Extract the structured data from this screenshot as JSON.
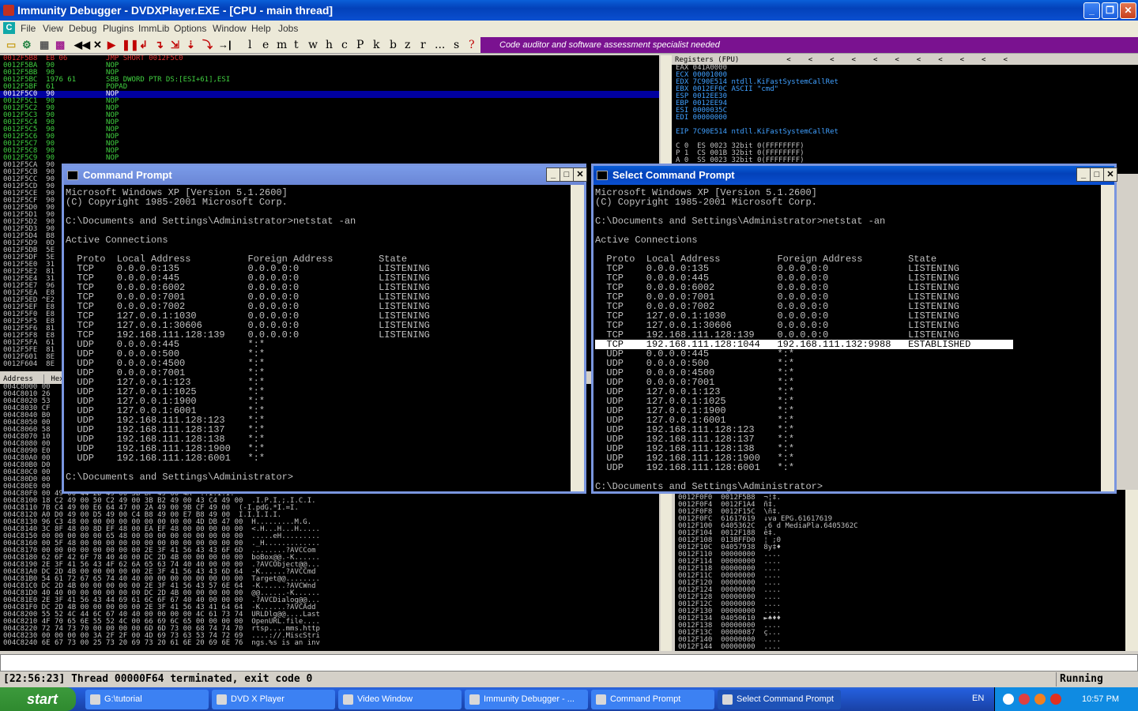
{
  "window": {
    "title": "Immunity Debugger - DVDXPlayer.EXE - [CPU - main thread]"
  },
  "menu": [
    "File",
    "View",
    "Debug",
    "Plugins",
    "ImmLib",
    "Options",
    "Window",
    "Help",
    "Jobs"
  ],
  "toolbar_letters": [
    "l",
    "e",
    "m",
    "t",
    "w",
    "h",
    "c",
    "P",
    "k",
    "b",
    "z",
    "r",
    "...",
    "s",
    "?"
  ],
  "banner": "Code auditor and software assessment specialist needed",
  "disasm": [
    "0012F5B8  EB 06         JMP SHORT 0012F5C0",
    "0012F5BA  90            NOP",
    "0012F5BB  90            NOP",
    "0012F5BC  1976 61       SBB DWORD PTR DS:[ESI+61],ESI",
    "0012F5BF  61            POPAD",
    "0012F5C0  90            NOP",
    "0012F5C1  90            NOP",
    "0012F5C2  90            NOP",
    "0012F5C3  90            NOP",
    "0012F5C4  90            NOP",
    "0012F5C5  90            NOP",
    "0012F5C6  90            NOP",
    "0012F5C7  90            NOP",
    "0012F5C8  90            NOP",
    "0012F5C9  90            NOP",
    "0012F5CA  90",
    "0012F5CB  90",
    "0012F5CC  90",
    "0012F5CD  90",
    "0012F5CE  90",
    "0012F5CF  90",
    "0012F5D0  90",
    "0012F5D1  90",
    "0012F5D2  90",
    "0012F5D3  90",
    "0012F5D4  B8",
    "0012F5D9  0D",
    "0012F5DB  5E",
    "0012F5DF  5E",
    "0012F5E0  31",
    "0012F5E2  81",
    "0012F5E4  31",
    "0012F5E7  96",
    "0012F5EA  E8",
    "0012F5ED ^E2",
    "0012F5EF  E8",
    "0012F5F0  E8",
    "0012F5F5  E8",
    "0012F5F6  81",
    "0012F5F8  E8",
    "0012F5FA  61",
    "0012F5FE  81",
    "0012F601  8E",
    "0012F604  8E"
  ],
  "registers": {
    "header": "Registers (FPU)",
    "rows": [
      "EAX 041A0000",
      "ECX 00001000",
      "EDX 7C90E514 ntdll.KiFastSystemCallRet",
      "EBX 0012EF0C ASCII \"cmd\"",
      "ESP 0012EE30",
      "EBP 0012EE94",
      "ESI 0000035C",
      "EDI 00000000",
      "",
      "EIP 7C90E514 ntdll.KiFastSystemCallRet",
      "",
      "C 0  ES 0023 32bit 0(FFFFFFFF)",
      "P 1  CS 001B 32bit 0(FFFFFFFF)",
      "A 0  SS 0023 32bit 0(FFFFFFFF)"
    ]
  },
  "dump": {
    "col_address": "Address",
    "col_hex": "Hex",
    "rows": [
      "004C8000 00",
      "004C8010 26",
      "004C8020 53",
      "004C8030 CF",
      "004C8040 B0",
      "004C8050 00",
      "004C8060 58",
      "004C8070 10",
      "004C8080 00",
      "004C8090 E0",
      "004C80A0 00",
      "004C80B0 D0",
      "004C80C0 00",
      "004C80D0 00",
      "004C80E0 00",
      "004C80F0 00 49 00 44 2D 49 00 3B BF 49 00 4A  ..I.I.I.",
      "004C8100 18 C2 49 00 50 C2 49 00 3B B2 49 00 43 C4 49 00  .I.P.I.;.I.C.I.",
      "004C8110 7B C4 49 00 E6 64 47 00 2A 49 00 9B CF 49 00  (-I.pdG.*I.=I.",
      "004C8120 A0 D0 49 00 D5 49 00 C4 B8 49 00 E7 B8 49 00  I.I.I.I.I.",
      "004C8130 96 C3 48 00 00 00 00 00 00 00 00 00 4D DB 47 00  H.........M.G.",
      "004C8140 3C 8F 48 00 8D EF 48 00 EA EF 48 00 00 00 00 00  <.H...H...H.....",
      "004C8150 00 00 00 00 00 65 48 00 00 00 00 00 00 00 00 00  .....eH.........",
      "004C8160 00 5F 48 00 00 00 00 00 00 00 00 00 00 00 00 00  ._H.............",
      "004C8170 00 00 00 00 00 00 00 00 2E 3F 41 56 43 43 6F 6D  ........?AVCCom",
      "004C8180 62 6F 42 6F 78 40 40 00 DC 2D 4B 00 00 00 00 00  boBox@@.-K......",
      "004C8190 2E 3F 41 56 43 4F 62 6A 65 63 74 40 40 00 00 00  .?AVCObject@@...",
      "004C81A0 DC 2D 4B 00 00 00 00 00 2E 3F 41 56 43 43 6D 64  -K......?AVCCmd",
      "004C81B0 54 61 72 67 65 74 40 40 00 00 00 00 00 00 00 00  Target@@........",
      "004C81C0 DC 2D 4B 00 00 00 00 00 2E 3F 41 56 43 57 6E 64  -K......?AVCWnd",
      "004C81D0 40 40 00 00 00 00 00 00 DC 2D 4B 00 00 00 00 00  @@......-K......",
      "004C81E0 2E 3F 41 56 43 44 69 61 6C 6F 67 40 40 00 00 00  .?AVCDialog@@...",
      "004C81F0 DC 2D 4B 00 00 00 00 00 2E 3F 41 56 43 41 64 64  -K......?AVCAdd",
      "004C8200 55 52 4C 44 6C 67 40 40 00 00 00 00 4C 61 73 74  URLDlg@@....Last",
      "004C8210 4F 70 65 6E 55 52 4C 00 66 69 6C 65 00 00 00 00  OpenURL.file....",
      "004C8220 72 74 73 70 00 00 00 00 6D 6D 73 00 68 74 74 70  rtsp....mms.http",
      "004C8230 00 00 00 00 3A 2F 2F 00 4D 69 73 63 53 74 72 69  ....://.MiscStri",
      "004C8240 6E 67 73 00 25 73 20 69 73 20 61 6E 20 69 6E 76  ngs.%s is an inv"
    ]
  },
  "stack": {
    "rows": [
      "0012F0F0  0012F5B8  ¬¦‡.",
      "0012F0F4  0012F1A4  ñ‡.",
      "0012F0F8  0012F15C  \\ñ‡.",
      "0012F0FC  61617619  ↓va EPG.61617619",
      "0012F100  6405362C  ,6 d MediaPla.6405362C",
      "0012F104  0012F188  ê‡.",
      "0012F108  013BFFD0  ¦ ;0",
      "0012F10C  04057938  8y‡♦",
      "0012F110  00000000  ....",
      "0012F114  00000000  ....",
      "0012F118  00000000  ....",
      "0012F11C  00000000  ....",
      "0012F120  00000000  ....",
      "0012F124  00000000  ....",
      "0012F128  00000000  ....",
      "0012F12C  00000000  ....",
      "0012F130  00000000  ....",
      "0012F134  04050610  ►♠♦♦",
      "0012F138  00000000  ....",
      "0012F13C  00000087  ç...",
      "0012F140  00000000  ....",
      "0012F144  00000000  ...."
    ]
  },
  "status": {
    "message": "[22:56:23] Thread 00000F64 terminated, exit code 0",
    "state": "Running"
  },
  "cmd1": {
    "title": "Command Prompt",
    "lines": [
      "Microsoft Windows XP [Version 5.1.2600]",
      "(C) Copyright 1985-2001 Microsoft Corp.",
      "",
      "C:\\Documents and Settings\\Administrator>netstat -an",
      "",
      "Active Connections",
      "",
      "  Proto  Local Address          Foreign Address        State",
      "  TCP    0.0.0.0:135            0.0.0.0:0              LISTENING",
      "  TCP    0.0.0.0:445            0.0.0.0:0              LISTENING",
      "  TCP    0.0.0.0:6002           0.0.0.0:0              LISTENING",
      "  TCP    0.0.0.0:7001           0.0.0.0:0              LISTENING",
      "  TCP    0.0.0.0:7002           0.0.0.0:0              LISTENING",
      "  TCP    127.0.0.1:1030         0.0.0.0:0              LISTENING",
      "  TCP    127.0.0.1:30606        0.0.0.0:0              LISTENING",
      "  TCP    192.168.111.128:139    0.0.0.0:0              LISTENING",
      "  UDP    0.0.0.0:445            *:*",
      "  UDP    0.0.0.0:500            *:*",
      "  UDP    0.0.0.0:4500           *:*",
      "  UDP    0.0.0.0:7001           *:*",
      "  UDP    127.0.0.1:123          *:*",
      "  UDP    127.0.0.1:1025         *:*",
      "  UDP    127.0.0.1:1900         *:*",
      "  UDP    127.0.0.1:6001         *:*",
      "  UDP    192.168.111.128:123    *:*",
      "  UDP    192.168.111.128:137    *:*",
      "  UDP    192.168.111.128:138    *:*",
      "  UDP    192.168.111.128:1900   *:*",
      "  UDP    192.168.111.128:6001   *:*",
      "",
      "C:\\Documents and Settings\\Administrator>"
    ]
  },
  "cmd2": {
    "title": "Select Command Prompt",
    "highlight_index": 16,
    "lines": [
      "Microsoft Windows XP [Version 5.1.2600]",
      "(C) Copyright 1985-2001 Microsoft Corp.",
      "",
      "C:\\Documents and Settings\\Administrator>netstat -an",
      "",
      "Active Connections",
      "",
      "  Proto  Local Address          Foreign Address        State",
      "  TCP    0.0.0.0:135            0.0.0.0:0              LISTENING",
      "  TCP    0.0.0.0:445            0.0.0.0:0              LISTENING",
      "  TCP    0.0.0.0:6002           0.0.0.0:0              LISTENING",
      "  TCP    0.0.0.0:7001           0.0.0.0:0              LISTENING",
      "  TCP    0.0.0.0:7002           0.0.0.0:0              LISTENING",
      "  TCP    127.0.0.1:1030         0.0.0.0:0              LISTENING",
      "  TCP    127.0.0.1:30606        0.0.0.0:0              LISTENING",
      "  TCP    192.168.111.128:139    0.0.0.0:0              LISTENING",
      "  TCP    192.168.111.128:1044   192.168.111.132:9988   ESTABLISHED",
      "  UDP    0.0.0.0:445            *:*",
      "  UDP    0.0.0.0:500            *:*",
      "  UDP    0.0.0.0:4500           *:*",
      "  UDP    0.0.0.0:7001           *:*",
      "  UDP    127.0.0.1:123          *:*",
      "  UDP    127.0.0.1:1025         *:*",
      "  UDP    127.0.0.1:1900         *:*",
      "  UDP    127.0.0.1:6001         *:*",
      "  UDP    192.168.111.128:123    *:*",
      "  UDP    192.168.111.128:137    *:*",
      "  UDP    192.168.111.128:138    *:*",
      "  UDP    192.168.111.128:1900   *:*",
      "  UDP    192.168.111.128:6001   *:*",
      "",
      "C:\\Documents and Settings\\Administrator>"
    ]
  },
  "taskbar": {
    "start": "start",
    "tasks": [
      "G:\\tutorial",
      "DVD X Player",
      "Video Window",
      "Immunity Debugger - ...",
      "Command Prompt",
      "Select Command Prompt"
    ],
    "lang": "EN",
    "clock": "10:57 PM"
  }
}
